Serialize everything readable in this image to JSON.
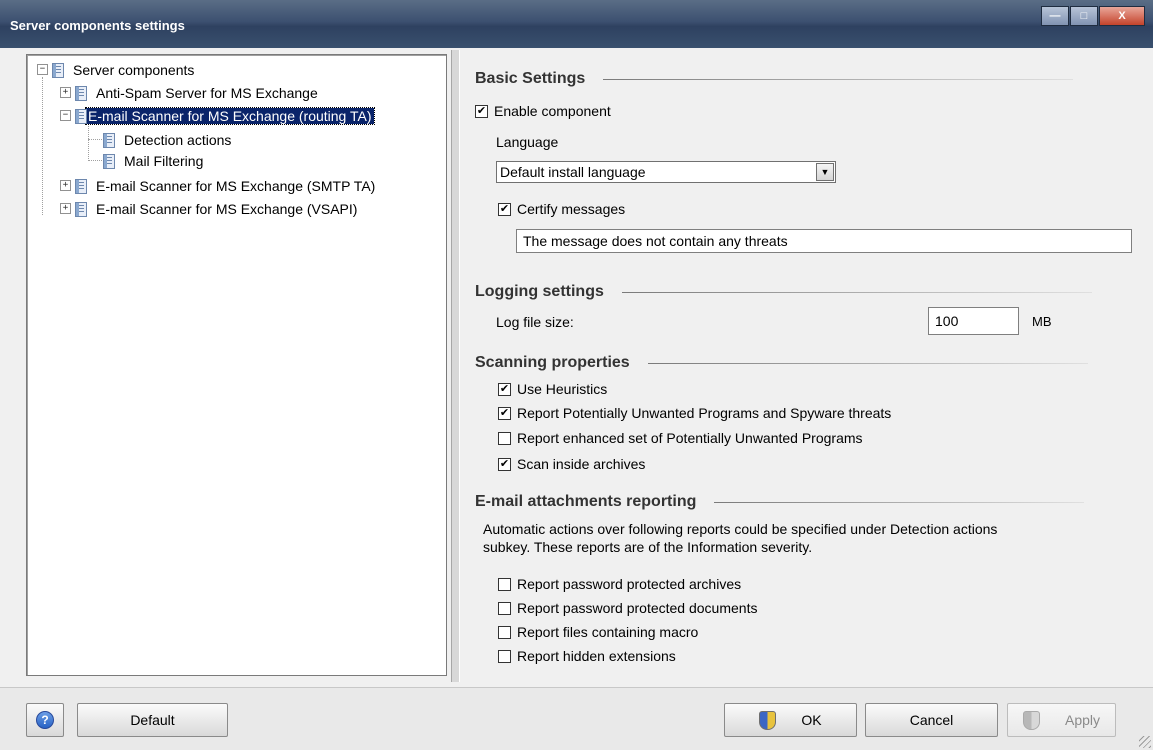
{
  "window": {
    "title": "Server components settings"
  },
  "tree": {
    "root": "Server components",
    "items": [
      {
        "label": "Anti-Spam Server for MS Exchange"
      },
      {
        "label": "E-mail Scanner for MS Exchange (routing TA)"
      },
      {
        "label": "Detection actions"
      },
      {
        "label": "Mail Filtering"
      },
      {
        "label": "E-mail Scanner for MS Exchange (SMTP TA)"
      },
      {
        "label": "E-mail Scanner for MS Exchange (VSAPI)"
      }
    ]
  },
  "basic": {
    "heading": "Basic Settings",
    "enable_component": "Enable component",
    "language_label": "Language",
    "language_value": "Default install language",
    "certify_messages": "Certify messages",
    "certify_text": "The message does not contain any threats"
  },
  "logging": {
    "heading": "Logging settings",
    "log_size_label": "Log file size:",
    "log_size_value": "100",
    "log_size_unit": "MB"
  },
  "scanning": {
    "heading": "Scanning properties",
    "options": [
      {
        "label": "Use Heuristics",
        "checked": true
      },
      {
        "label": "Report Potentially Unwanted Programs and Spyware threats",
        "checked": true
      },
      {
        "label": "Report enhanced set of Potentially Unwanted Programs",
        "checked": false
      },
      {
        "label": "Scan inside archives",
        "checked": true
      }
    ]
  },
  "attachments": {
    "heading": "E-mail attachments reporting",
    "description_line1": "Automatic actions over following reports could be specified under Detection actions",
    "description_line2": "subkey. These reports are of the Information severity.",
    "options": [
      {
        "label": "Report password protected archives",
        "checked": false
      },
      {
        "label": "Report password protected documents",
        "checked": false
      },
      {
        "label": "Report files containing macro",
        "checked": false
      },
      {
        "label": "Report hidden extensions",
        "checked": false
      }
    ]
  },
  "buttons": {
    "help_glyph": "?",
    "default": "Default",
    "ok": "OK",
    "cancel": "Cancel",
    "apply": "Apply"
  },
  "glyphs": {
    "check": "✔",
    "expand": "+",
    "collapse": "−",
    "dropdown": "▼",
    "minimize": "—",
    "maximize": "□",
    "close": "X"
  }
}
